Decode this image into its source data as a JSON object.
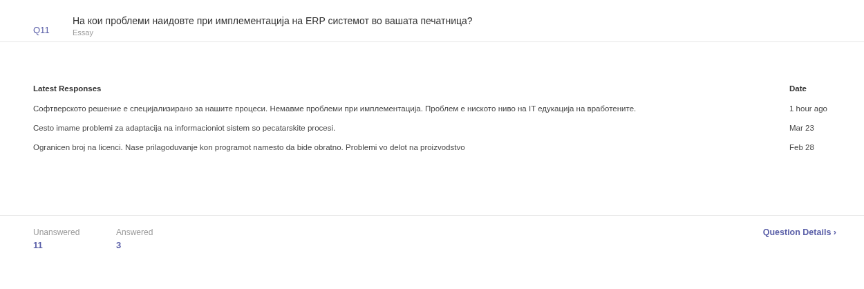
{
  "question": {
    "number": "Q11",
    "text": "На кои проблеми наидовте при имплементација на ERP системот во вашата печатница?",
    "type": "Essay"
  },
  "responses": {
    "columns": [
      "Latest Responses",
      "Date"
    ],
    "rows": [
      {
        "text": "Софтверското решение е специјализирано за нашите процеси. Немавме проблеми при имплементација. Проблем е нискотo ниво на IT едукација на вработените.",
        "date": "1 hour ago"
      },
      {
        "text": "Cesto imame problemi za adaptacija na informacioniot sistem so pecatarskite procesi.",
        "date": "Mar 23"
      },
      {
        "text": "Ogranicen broj na licenci. Nase prilagoduvanje kon programot namesto da bide obratno. Problemi vo delot na proizvodstvo",
        "date": "Feb 28"
      }
    ]
  },
  "stats": [
    {
      "label": "Unanswered",
      "value": "11"
    },
    {
      "label": "Answered",
      "value": "3"
    }
  ],
  "details_link": {
    "label": "Question Details",
    "icon": "›"
  }
}
